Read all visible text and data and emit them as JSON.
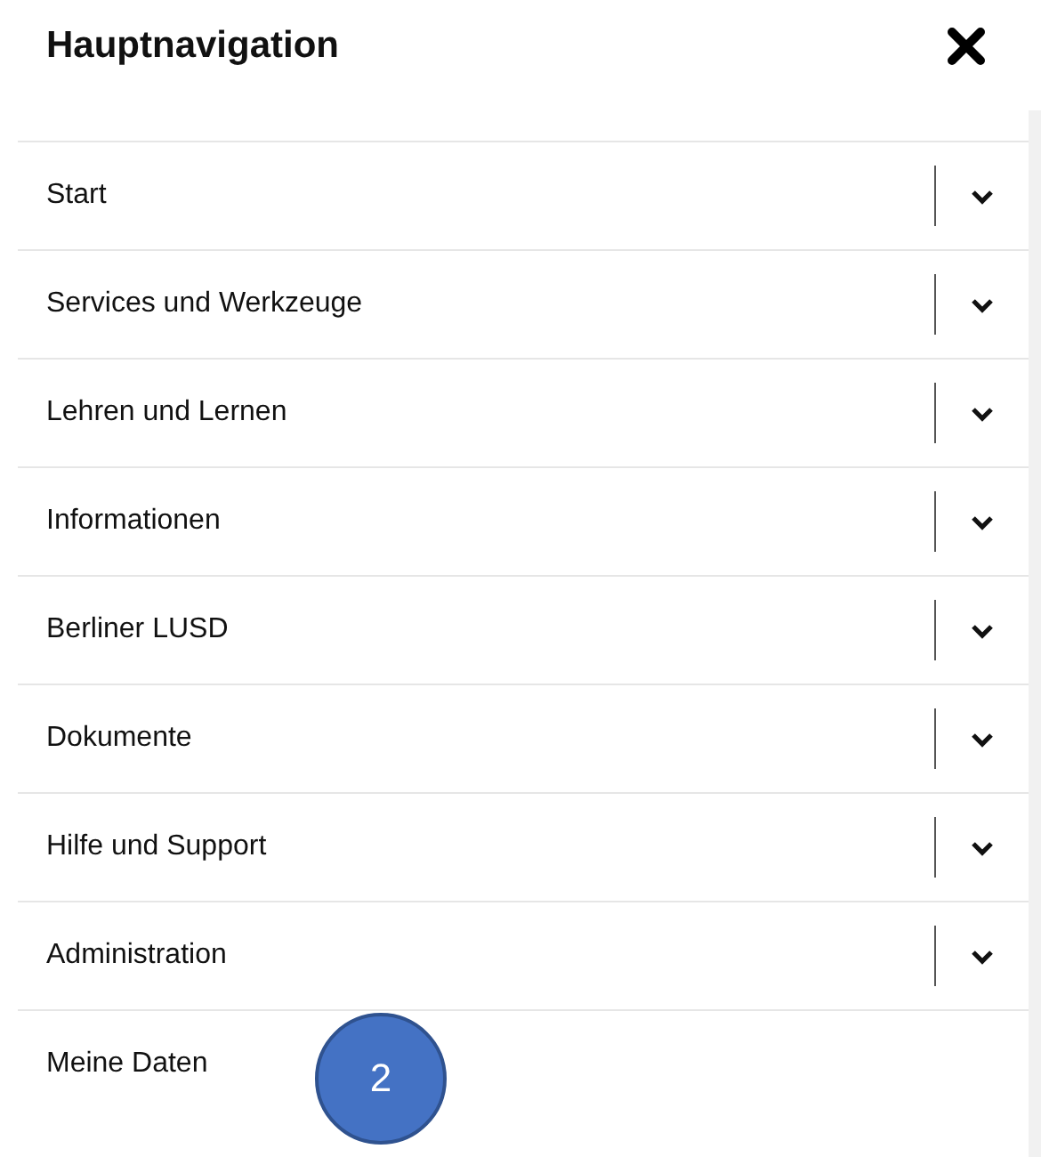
{
  "header": {
    "title": "Hauptnavigation"
  },
  "menu": [
    {
      "label": "Start",
      "expandable": true
    },
    {
      "label": "Services und Werkzeuge",
      "expandable": true
    },
    {
      "label": "Lehren und Lernen",
      "expandable": true
    },
    {
      "label": "Informationen",
      "expandable": true
    },
    {
      "label": "Berliner LUSD",
      "expandable": true
    },
    {
      "label": "Dokumente",
      "expandable": true
    },
    {
      "label": "Hilfe und Support",
      "expandable": true
    },
    {
      "label": "Administration",
      "expandable": true
    },
    {
      "label": "Meine Daten",
      "expandable": false
    }
  ],
  "callout": {
    "number": "2"
  }
}
